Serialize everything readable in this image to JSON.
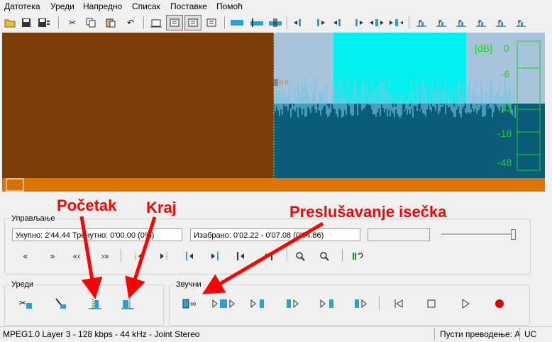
{
  "menu": [
    "Датотека",
    "Уреди",
    "Напредно",
    "Списак",
    "Поставке",
    "Помоћ"
  ],
  "waveform": {
    "marker_label": "0.0",
    "db_unit": "[dB]",
    "db_ticks": [
      "0",
      "-6",
      "-12",
      "-18",
      "-48"
    ],
    "colors": {
      "brown": "#7a3e06",
      "wave_bg": "#0b5c78",
      "selection": "#00f0f0",
      "light": "#a8c4dc",
      "wave_line": "#70c8e6",
      "meter": "#22d022",
      "orange": "#dc7400"
    }
  },
  "controls": {
    "title": "Управљање",
    "total_field": "Укупно: 2'44.44   Тренутно: 0'00.00  (0%)",
    "selected_field": "Изабрано: 0'02.22 - 0'07.08 (0'04.86)"
  },
  "edit_panel": {
    "title": "Уреди"
  },
  "sound_panel": {
    "title": "Звучни"
  },
  "annotations": {
    "start": "Početak",
    "end": "Kraj",
    "preview": "Preslušavanje isečka"
  },
  "status": {
    "format": "MPEG1.0 Layer 3 - 128 kbps - 44 kHz - Joint Stereo",
    "translator": "Пусти преводење: А",
    "caps": "UC"
  }
}
